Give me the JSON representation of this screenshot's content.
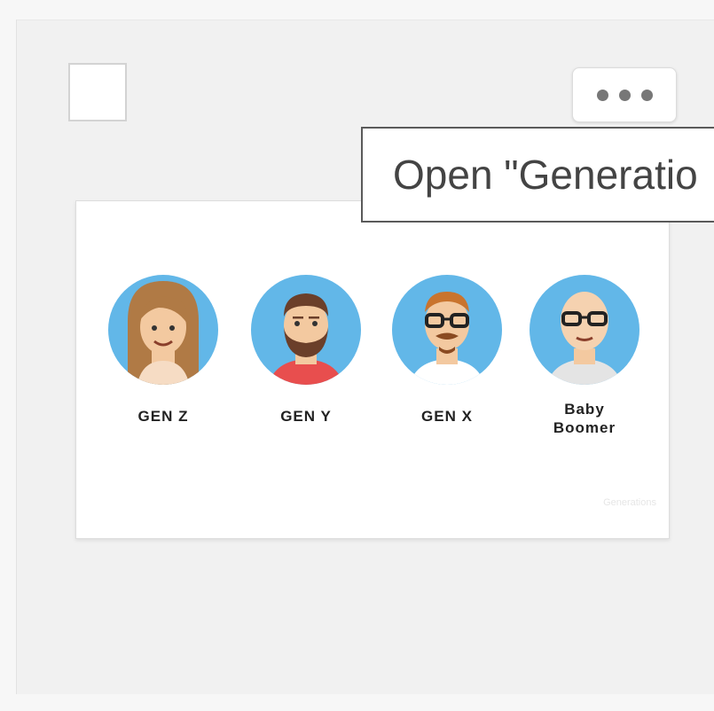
{
  "item": {
    "checkbox_checked": false,
    "more_icon": "ellipsis-icon",
    "tooltip_text": "Open \"Generatio"
  },
  "thumbnail": {
    "people": [
      {
        "label": "GEN Z",
        "avatar": "female-long-hair-avatar"
      },
      {
        "label": "GEN Y",
        "avatar": "bearded-man-avatar"
      },
      {
        "label": "GEN X",
        "avatar": "man-glasses-mustache-avatar"
      },
      {
        "label": "Baby Boomer",
        "avatar": "bald-man-glasses-avatar"
      }
    ],
    "watermark": "Generations"
  },
  "colors": {
    "avatar_bg": "#62b7e8",
    "skin": "#f3c9a0",
    "shirt_gen_y": "#e84e4e"
  }
}
